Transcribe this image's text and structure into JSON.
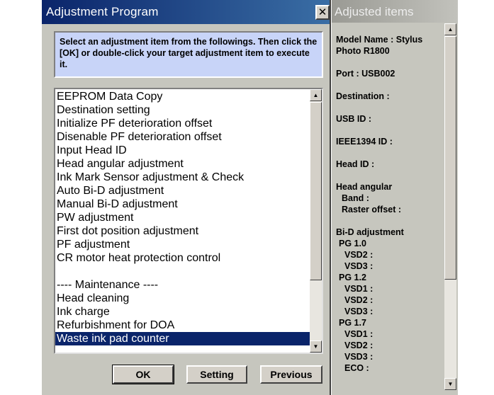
{
  "dialog": {
    "title": "Adjustment Program",
    "close_glyph": "✕",
    "instruction": "Select an adjustment item from the followings. Then click the [OK] or double-click your target adjustment item to execute it.",
    "items": [
      "EEPROM Data Copy",
      "Destination setting",
      "Initialize PF deterioration offset",
      "Disenable PF deterioration offset",
      "Input Head ID",
      "Head angular adjustment",
      "Ink Mark Sensor adjustment & Check",
      "Auto Bi-D adjustment",
      "Manual Bi-D adjustment",
      "PW adjustment",
      "First dot position adjustment",
      "PF adjustment",
      "CR motor heat protection control",
      "",
      "---- Maintenance ----",
      "Head cleaning",
      "Ink charge",
      "Refurbishment for DOA",
      "Waste ink pad counter"
    ],
    "selected_index": 18,
    "buttons": {
      "ok": "OK",
      "setting": "Setting",
      "previous": "Previous"
    }
  },
  "panel": {
    "title": "Adjusted items",
    "lines": [
      "Model Name : Stylus",
      "Photo R1800",
      "Port : USB002",
      "Destination :",
      "USB ID :",
      "IEEE1394 ID :",
      "Head ID :",
      "Head angular",
      "Band :",
      "Raster offset :",
      "Bi-D adjustment",
      "PG 1.0",
      "VSD2 :",
      "VSD3 :",
      "PG 1.2",
      "VSD1 :",
      "VSD2 :",
      "VSD3 :",
      "PG 1.7",
      "VSD1 :",
      "VSD2 :",
      "VSD3 :",
      "ECO :"
    ]
  },
  "colors": {
    "titlebar": "#0a246a",
    "selection": "#0a246a",
    "instruction_bg": "#c8d4f8",
    "window_bg": "#c6c6be"
  },
  "icons": {
    "scroll_up": "triangle-up-icon",
    "scroll_down": "triangle-down-icon",
    "close": "close-icon"
  }
}
